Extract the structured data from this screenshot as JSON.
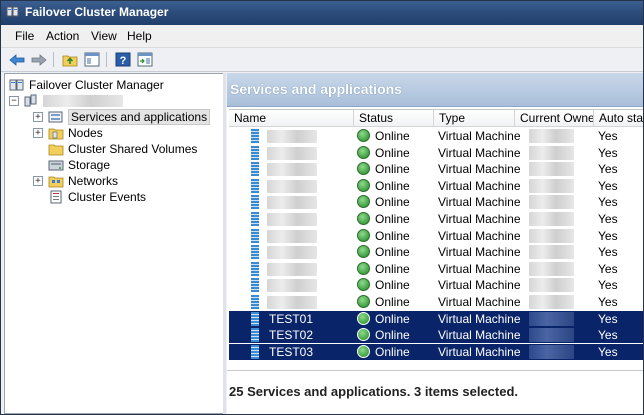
{
  "window": {
    "title": "Failover Cluster Manager"
  },
  "menu": [
    "File",
    "Action",
    "View",
    "Help"
  ],
  "toolbar": {
    "buttons": [
      "back-arrow-icon",
      "forward-arrow-icon",
      "up-folder-icon",
      "show-hide-tree-icon",
      "help-icon",
      "action-pane-icon"
    ]
  },
  "tree": {
    "root": "Failover Cluster Manager",
    "items": [
      {
        "label": "Services and applications",
        "icon": "services-icon",
        "expandable": true
      },
      {
        "label": "Nodes",
        "icon": "nodes-folder-icon",
        "expandable": true
      },
      {
        "label": "Cluster Shared Volumes",
        "icon": "folder-icon",
        "expandable": false
      },
      {
        "label": "Storage",
        "icon": "storage-icon",
        "expandable": false
      },
      {
        "label": "Networks",
        "icon": "networks-icon",
        "expandable": true
      },
      {
        "label": "Cluster Events",
        "icon": "events-icon",
        "expandable": false
      }
    ]
  },
  "panel": {
    "title": "Services and applications",
    "columns": [
      "Name",
      "Status",
      "Type",
      "Current Owner",
      "Auto star"
    ],
    "rows": [
      {
        "name": "",
        "status": "Online",
        "type": "Virtual Machine",
        "auto_start": "Yes",
        "selected": false
      },
      {
        "name": "",
        "status": "Online",
        "type": "Virtual Machine",
        "auto_start": "Yes",
        "selected": false
      },
      {
        "name": "",
        "status": "Online",
        "type": "Virtual Machine",
        "auto_start": "Yes",
        "selected": false
      },
      {
        "name": "",
        "status": "Online",
        "type": "Virtual Machine",
        "auto_start": "Yes",
        "selected": false
      },
      {
        "name": "",
        "status": "Online",
        "type": "Virtual Machine",
        "auto_start": "Yes",
        "selected": false
      },
      {
        "name": "",
        "status": "Online",
        "type": "Virtual Machine",
        "auto_start": "Yes",
        "selected": false
      },
      {
        "name": "",
        "status": "Online",
        "type": "Virtual Machine",
        "auto_start": "Yes",
        "selected": false
      },
      {
        "name": "",
        "status": "Online",
        "type": "Virtual Machine",
        "auto_start": "Yes",
        "selected": false
      },
      {
        "name": "",
        "status": "Online",
        "type": "Virtual Machine",
        "auto_start": "Yes",
        "selected": false
      },
      {
        "name": "",
        "status": "Online",
        "type": "Virtual Machine",
        "auto_start": "Yes",
        "selected": false
      },
      {
        "name": "",
        "status": "Online",
        "type": "Virtual Machine",
        "auto_start": "Yes",
        "selected": false
      },
      {
        "name": "TEST01",
        "status": "Online",
        "type": "Virtual Machine",
        "auto_start": "Yes",
        "selected": true
      },
      {
        "name": "TEST02",
        "status": "Online",
        "type": "Virtual Machine",
        "auto_start": "Yes",
        "selected": true
      },
      {
        "name": "TEST03",
        "status": "Online",
        "type": "Virtual Machine",
        "auto_start": "Yes",
        "selected": true
      }
    ],
    "summary": "25 Services and applications. 3 items selected."
  },
  "colors": {
    "selection": "#0a246a",
    "titlebar": "#2a4a78",
    "header_band": "#b5c9e0"
  }
}
